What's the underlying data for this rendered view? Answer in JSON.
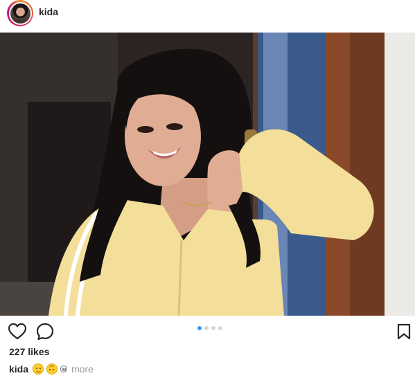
{
  "header": {
    "username": "kida",
    "avatar_icon": "profile-avatar"
  },
  "photo": {
    "alt": "photo",
    "colors": {
      "jacket": "#f3df99",
      "hair": "#141010",
      "skin": "#e0ad94",
      "door": "#6e3a22",
      "wall": "#ebeae7",
      "background": "#2a2321"
    }
  },
  "actions": {
    "like_icon": "heart-outline-icon",
    "comment_icon": "comment-bubble-icon",
    "save_icon": "bookmark-icon",
    "carousel": {
      "total": 4,
      "active_index": 0,
      "active_color": "#3897f0",
      "inactive_color": "#d6d6d6"
    }
  },
  "likes": {
    "text": "227 likes"
  },
  "caption": {
    "username": "kida",
    "emojis": [
      "smiling-face",
      "upside-down-face",
      "small-face"
    ],
    "more_label": "more"
  }
}
